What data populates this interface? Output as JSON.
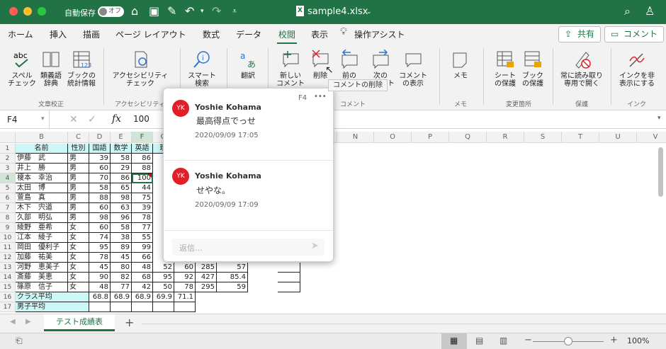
{
  "titlebar": {
    "autosave": "自動保存",
    "toggle": "オフ",
    "filename": "sample4.xlsx"
  },
  "menu": {
    "items": [
      "ホーム",
      "挿入",
      "描画",
      "ページ レイアウト",
      "数式",
      "データ",
      "校閲",
      "表示",
      "操作アシスト"
    ],
    "active": "校閲",
    "share": "共有",
    "comment": "コメント"
  },
  "ribbon": {
    "spell": "スペル\nチェック",
    "thesaurus": "類義語\n辞典",
    "stats": "ブックの\n統計情報",
    "access": "アクセシビリティ\nチェック",
    "smart": "スマート\n検索",
    "translate": "翻訳",
    "newcomment": "新しい\nコメント",
    "delete": "削除",
    "prev": "前の\nコメント",
    "next": "次の\nコメント",
    "show": "コメント\nの表示",
    "memo": "メモ",
    "protect_sheet": "シート\nの保護",
    "protect_book": "ブック\nの保護",
    "readonly": "常に読み取り\n専用で開く",
    "ink": "インクを非\n表示にする",
    "groups": {
      "proof": "文章校正",
      "access": "アクセシビリティ",
      "comment": "コメント",
      "memo": "メモ",
      "changes": "変更箇所",
      "protect": "保護",
      "ink": "インク"
    }
  },
  "formula": {
    "namebox": "F4",
    "value": "100"
  },
  "columns": [
    "B",
    "C",
    "D",
    "E",
    "F",
    "G",
    "N",
    "O",
    "P",
    "Q",
    "R",
    "S",
    "T",
    "U",
    "V"
  ],
  "rows": [
    1,
    2,
    3,
    4,
    5,
    6,
    7,
    8,
    9,
    10,
    11,
    12,
    13,
    14,
    15,
    16,
    17
  ],
  "table": {
    "headers": [
      "名前",
      "性別",
      "国語",
      "数学",
      "英語",
      "理"
    ],
    "data": [
      [
        "伊藤　武",
        "男",
        "39",
        "58",
        "86"
      ],
      [
        "井上　勝",
        "男",
        "60",
        "29",
        "88"
      ],
      [
        "榎本　幸治",
        "男",
        "70",
        "86",
        "100"
      ],
      [
        "太田　博",
        "男",
        "58",
        "65",
        "44"
      ],
      [
        "萱島　真",
        "男",
        "88",
        "98",
        "75"
      ],
      [
        "木下　宍道",
        "男",
        "60",
        "63",
        "39"
      ],
      [
        "久部　明弘",
        "男",
        "98",
        "96",
        "78"
      ],
      [
        "綾野　亜希",
        "女",
        "60",
        "58",
        "77"
      ],
      [
        "江本　綾子",
        "女",
        "74",
        "38",
        "55"
      ],
      [
        "岡田　優利子",
        "女",
        "95",
        "89",
        "99"
      ],
      [
        "加藤　祐美",
        "女",
        "78",
        "45",
        "66"
      ],
      [
        "河野　恵美子",
        "女",
        "45",
        "80",
        "48",
        "52",
        "60",
        "285",
        "57"
      ],
      [
        "斎藤　美恵",
        "女",
        "90",
        "82",
        "68",
        "95",
        "92",
        "427",
        "85.4"
      ],
      [
        "篠原　信子",
        "女",
        "48",
        "77",
        "42",
        "50",
        "78",
        "295",
        "59"
      ]
    ],
    "avg_class": [
      "クラス平均",
      "68.8",
      "68.9",
      "68.9",
      "69.9",
      "71.1"
    ],
    "avg_male": "男子平均"
  },
  "popup": {
    "cell": "F4",
    "more": "•••",
    "c1": {
      "initials": "YK",
      "author": "Yoshie Kohama",
      "text": "最高得点でっせ",
      "time": "2020/09/09 17:05"
    },
    "c2": {
      "initials": "YK",
      "author": "Yoshie Kohama",
      "text": "せやな。",
      "time": "2020/09/09 17:09"
    },
    "reply_placeholder": "返信..."
  },
  "tooltip": "コメントの削除",
  "sheet_tab": "テスト成績表",
  "status": {
    "zoom": "100%"
  },
  "colors": {
    "excel_green": "#217346",
    "header_fill": "#cdf6f6",
    "avatar": "#e21f26"
  }
}
